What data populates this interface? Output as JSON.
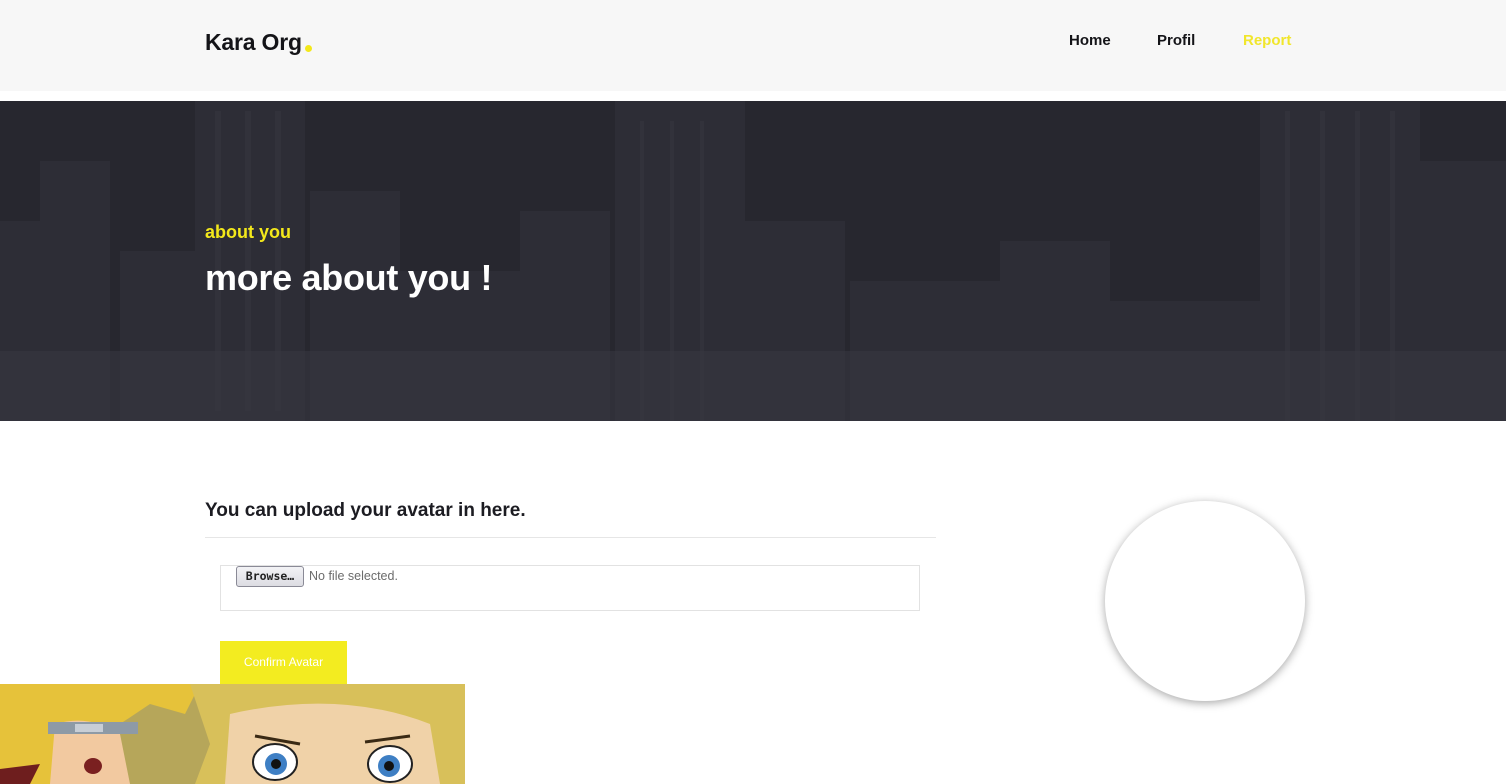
{
  "header": {
    "brand": "Kara Org",
    "nav": [
      {
        "label": "Home",
        "active": false
      },
      {
        "label": "Profil",
        "active": false
      },
      {
        "label": "Report",
        "active": true
      }
    ]
  },
  "hero": {
    "subtitle": "about you",
    "title": "more about you !"
  },
  "upload": {
    "title": "You can upload your avatar in here.",
    "browse_label": "Browse…",
    "file_status": "No file selected.",
    "confirm_label": "Confirm Avatar"
  },
  "colors": {
    "accent": "#f3e81b",
    "header_bg": "#f7f7f7",
    "hero_bg": "#2b2b33",
    "text_dark": "#1c1c22"
  }
}
